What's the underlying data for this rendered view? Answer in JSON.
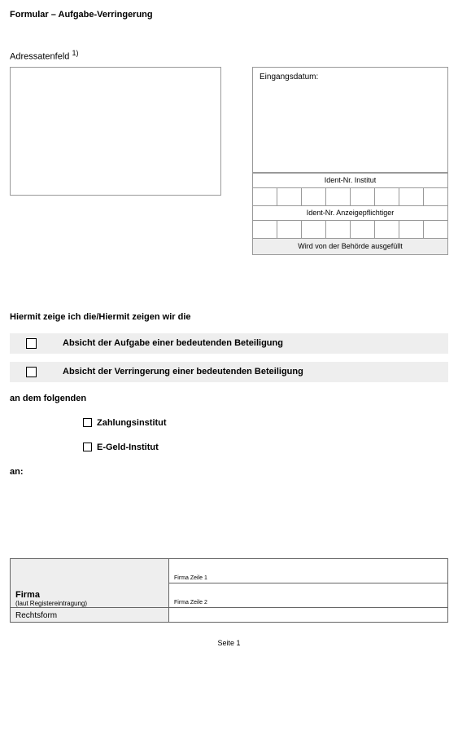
{
  "title": "Formular – Aufgabe-Verringerung",
  "adr_label": "Adressatenfeld",
  "adr_foot": "1)",
  "eingang_label": "Eingangsdatum:",
  "ident_institut": "Ident-Nr. Institut",
  "ident_anzeige": "Ident-Nr. Anzeigepflichtiger",
  "behorde_note": "Wird von der Behörde ausgefüllt",
  "intro": "Hiermit zeige ich die/Hiermit zeigen wir die",
  "option1": "Absicht der Aufgabe einer bedeutenden Beteiligung",
  "option2": "Absicht der Verringerung einer bedeutenden Beteiligung",
  "sub_intro": "an dem folgenden",
  "inst1": "Zahlungsinstitut",
  "inst2": "E-Geld-Institut",
  "an_label": "an:",
  "firma_label": "Firma",
  "firma_sub": "(laut Registereintragung)",
  "firma_z1": "Firma Zeile 1",
  "firma_z2": "Firma Zeile 2",
  "rechtsform": "Rechtsform",
  "page": "Seite 1"
}
